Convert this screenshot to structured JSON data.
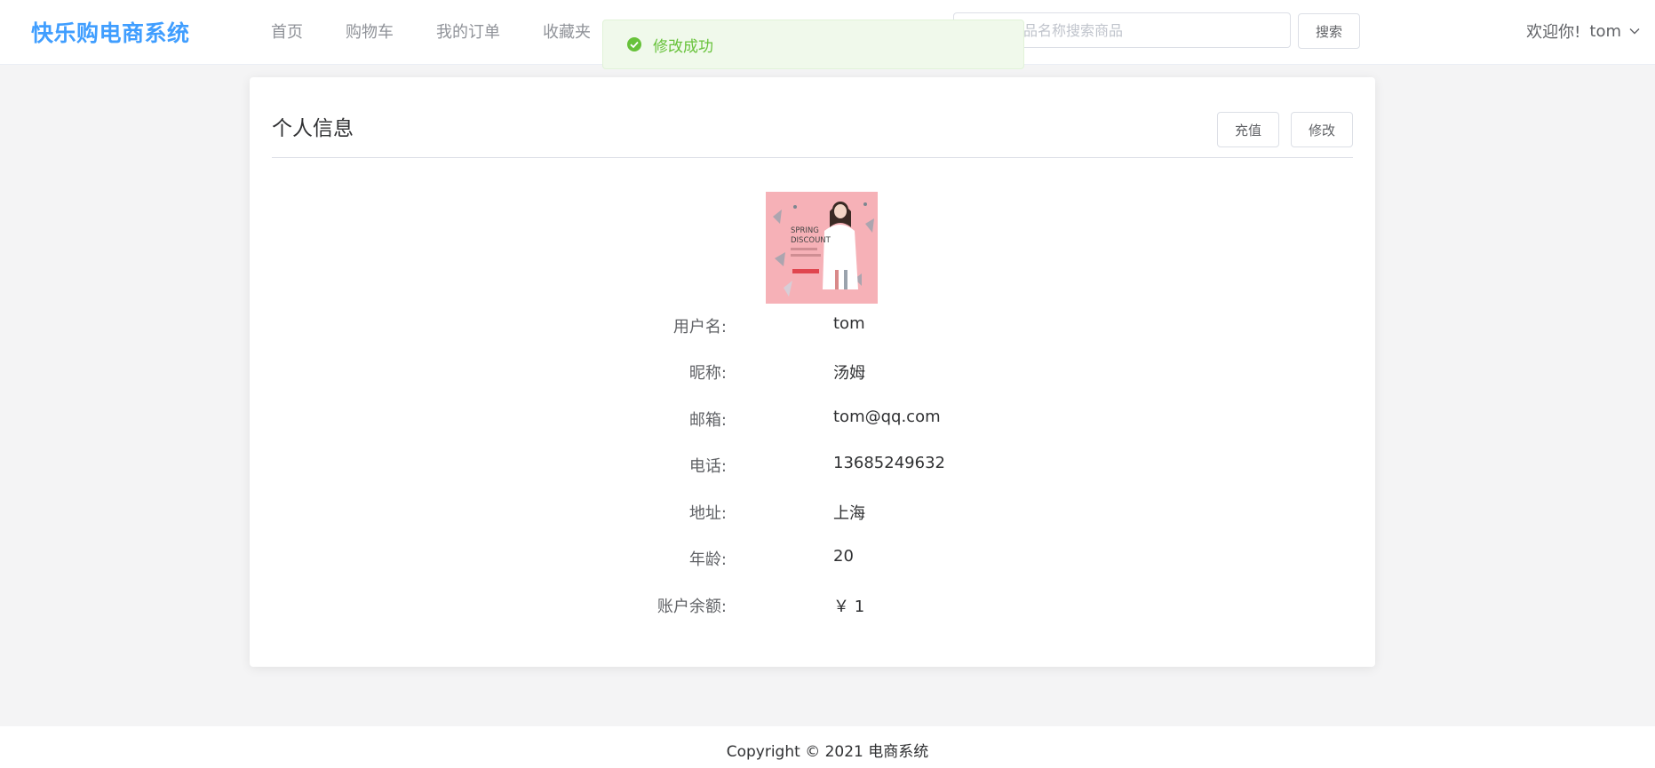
{
  "header": {
    "brand": "快乐购电商系统",
    "nav": [
      "首页",
      "购物车",
      "我的订单",
      "收藏夹"
    ],
    "search_placeholder": "请输入商品名称搜索商品",
    "search_button": "搜索",
    "greeting": "欢迎你!",
    "username": "tom"
  },
  "toast": {
    "message": "修改成功"
  },
  "profile": {
    "title": "个人信息",
    "recharge_button": "充值",
    "edit_button": "修改",
    "avatar_texts": [
      "SPRING",
      "DISCOUNT"
    ],
    "fields": [
      {
        "label": "用户名:",
        "value": "tom"
      },
      {
        "label": "昵称:",
        "value": "汤姆"
      },
      {
        "label": "邮箱:",
        "value": "tom@qq.com"
      },
      {
        "label": "电话:",
        "value": "13685249632"
      },
      {
        "label": "地址:",
        "value": "上海"
      },
      {
        "label": "年龄:",
        "value": "20"
      },
      {
        "label": "账户余额:",
        "value": "￥ 1"
      }
    ]
  },
  "footer": {
    "copyright": "Copyright © 2021 电商系统"
  },
  "colors": {
    "primary": "#409eff",
    "success": "#67c23a",
    "success_bg": "#f0f9eb"
  }
}
